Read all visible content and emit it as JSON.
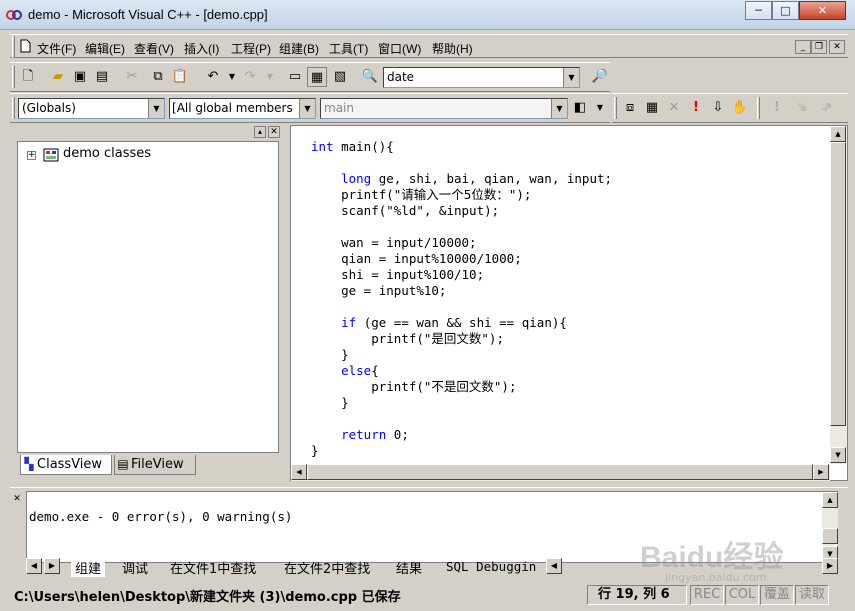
{
  "window": {
    "title": "demo - Microsoft Visual C++ - [demo.cpp]",
    "min": "─",
    "max": "□",
    "close": "✕"
  },
  "menu": {
    "items": [
      "文件(F)",
      "编辑(E)",
      "查看(V)",
      "插入(I)",
      "工程(P)",
      "组建(B)",
      "工具(T)",
      "窗口(W)",
      "帮助(H)"
    ]
  },
  "toolbar": {
    "find_value": "date"
  },
  "wizardbar": {
    "scope": "(Globals)",
    "filter": "All global members",
    "member": "main"
  },
  "classview": {
    "root": "demo classes",
    "tabs": [
      "ClassView",
      "FileView"
    ]
  },
  "editor": {
    "lines": [
      [
        {
          "t": "int",
          "k": true
        },
        {
          "t": " main(){"
        }
      ],
      [
        {
          "t": ""
        }
      ],
      [
        {
          "t": "    "
        },
        {
          "t": "long",
          "k": true
        },
        {
          "t": " ge, shi, bai, qian, wan, input;"
        }
      ],
      [
        {
          "t": "    printf(\"请输入一个5位数：\");"
        }
      ],
      [
        {
          "t": "    scanf(\"%ld\", &input);"
        }
      ],
      [
        {
          "t": ""
        }
      ],
      [
        {
          "t": "    wan = input/10000;"
        }
      ],
      [
        {
          "t": "    qian = input%10000/1000;"
        }
      ],
      [
        {
          "t": "    shi = input%100/10;"
        }
      ],
      [
        {
          "t": "    ge = input%10;"
        }
      ],
      [
        {
          "t": ""
        }
      ],
      [
        {
          "t": "    "
        },
        {
          "t": "if",
          "k": true
        },
        {
          "t": " (ge == wan && shi == qian){"
        }
      ],
      [
        {
          "t": "        printf(\"是回文数\");"
        }
      ],
      [
        {
          "t": "    }"
        }
      ],
      [
        {
          "t": "    "
        },
        {
          "t": "else",
          "k": true
        },
        {
          "t": "{"
        }
      ],
      [
        {
          "t": "        printf(\"不是回文数\");"
        }
      ],
      [
        {
          "t": "    }"
        }
      ],
      [
        {
          "t": ""
        }
      ],
      [
        {
          "t": "    "
        },
        {
          "t": "return",
          "k": true
        },
        {
          "t": " 0;"
        }
      ],
      [
        {
          "t": "}"
        }
      ]
    ]
  },
  "output": {
    "text": "demo.exe - 0 error(s), 0 warning(s)",
    "tabs": [
      "组建",
      "调试",
      "在文件1中查找",
      "在文件2中查找",
      "结果",
      "SQL Debuggin"
    ]
  },
  "status": {
    "message": "C:\\Users\\helen\\Desktop\\新建文件夹 (3)\\demo.cpp 已保存",
    "position": "行 19, 列 6",
    "rec": "REC",
    "col": "COL",
    "ovr": "覆盖",
    "read": "读取"
  },
  "watermark": {
    "text": "Baidu经验",
    "url": "jingyan.baidu.com"
  },
  "colors": {
    "keyword": "#0000ff",
    "title_bg": "#c2d4e8",
    "chrome": "#d4d0c8"
  }
}
